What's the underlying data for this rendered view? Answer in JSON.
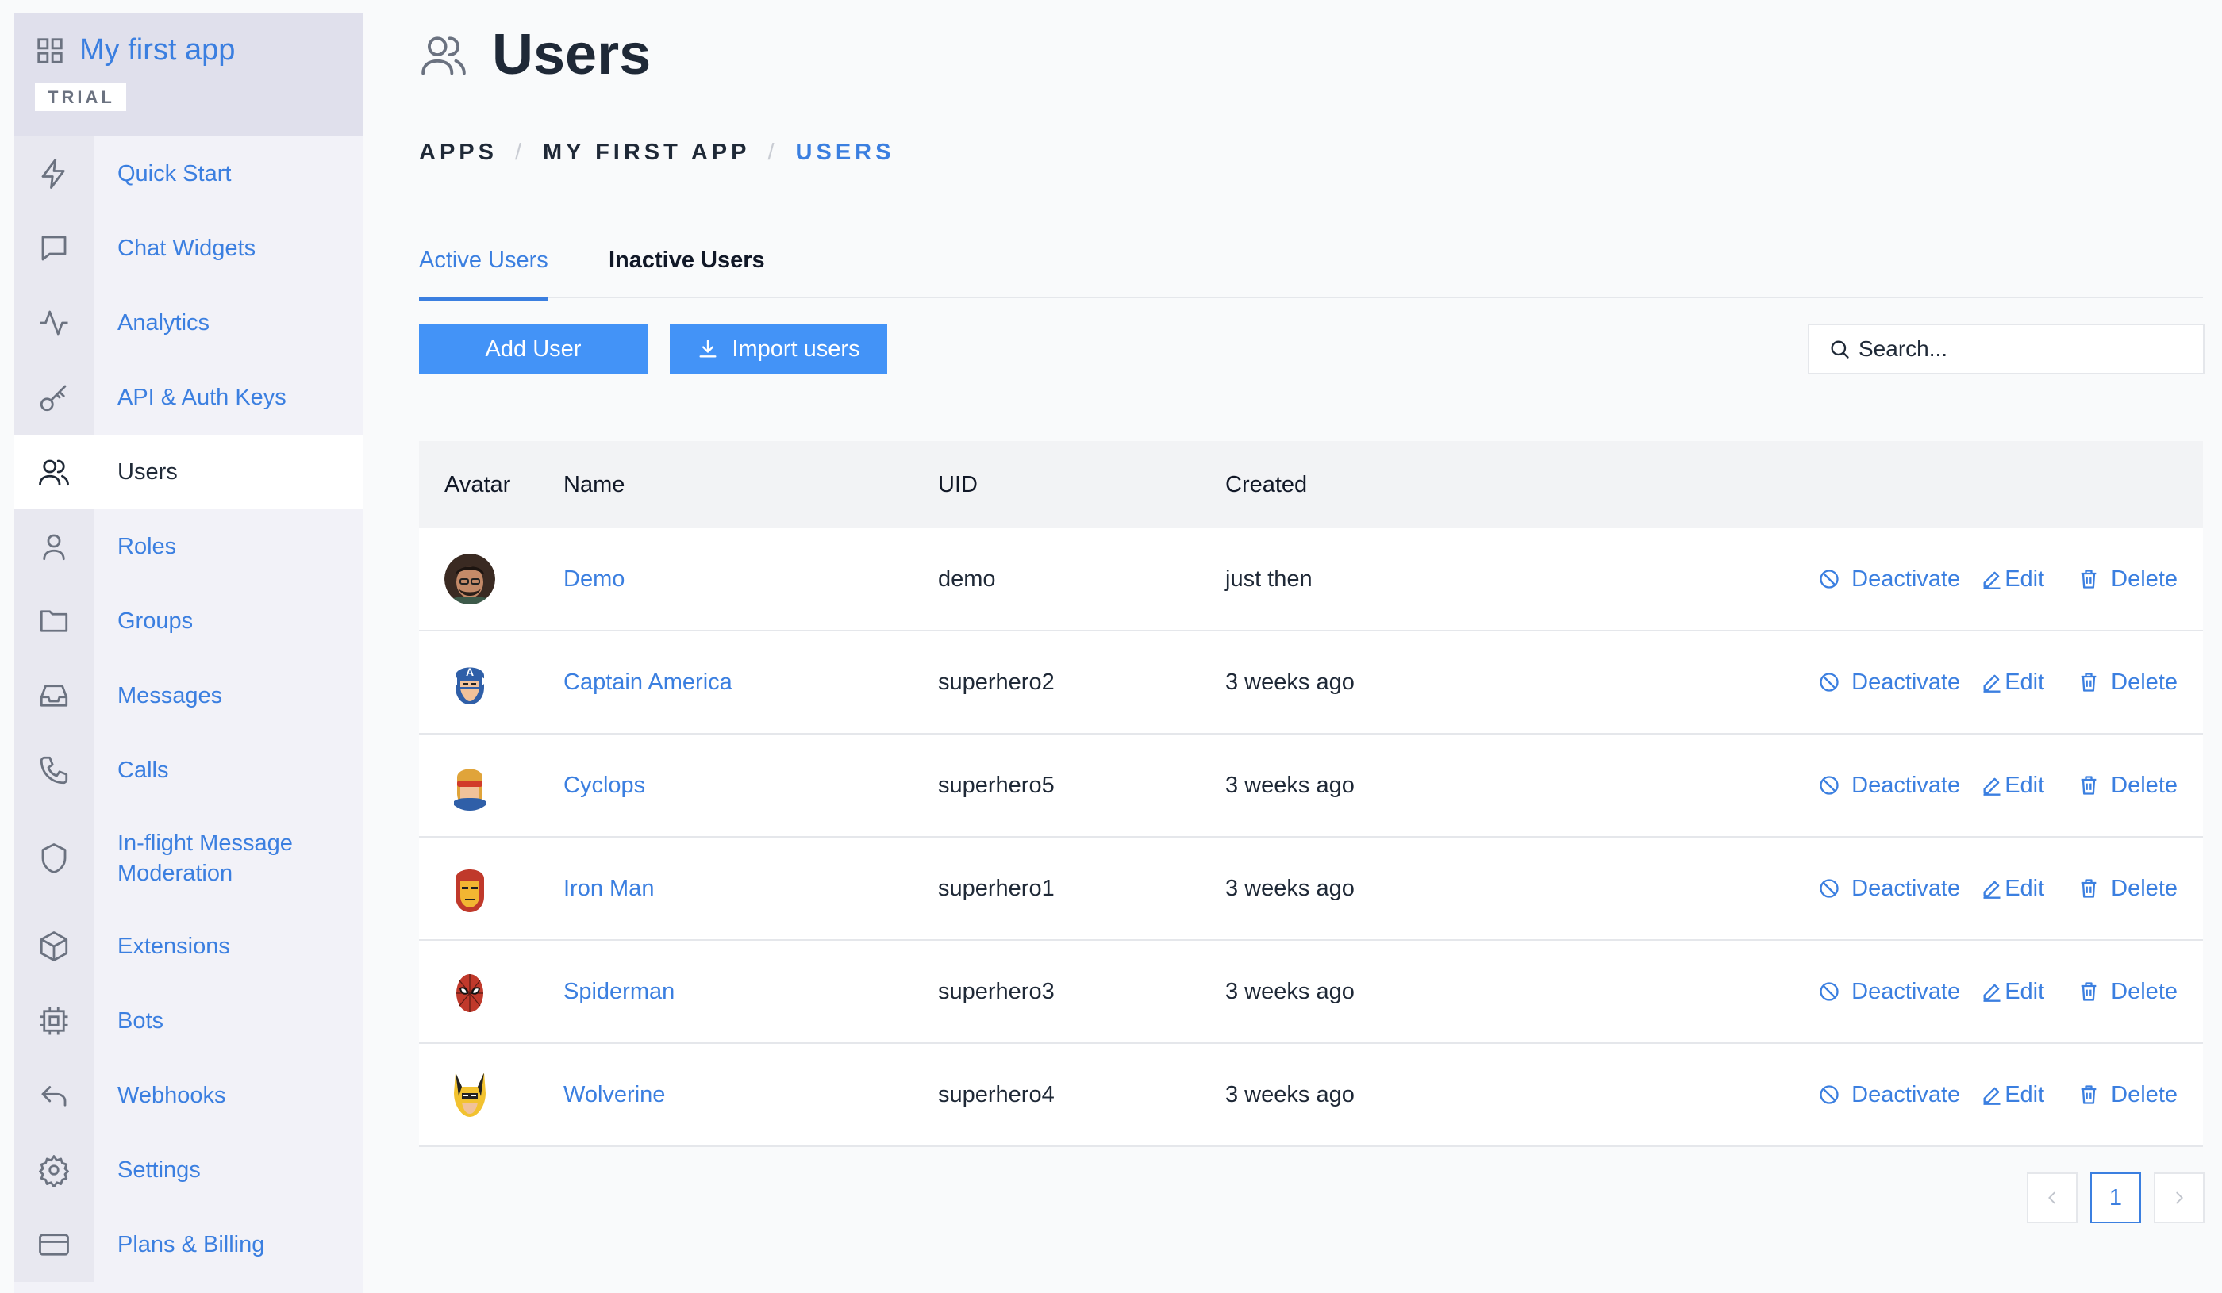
{
  "app": {
    "name": "My first app",
    "badge": "TRIAL"
  },
  "sidebar": {
    "items": [
      {
        "label": "Quick Start",
        "icon": "lightning-icon"
      },
      {
        "label": "Chat Widgets",
        "icon": "chat-icon"
      },
      {
        "label": "Analytics",
        "icon": "activity-icon"
      },
      {
        "label": "API & Auth Keys",
        "icon": "key-icon"
      },
      {
        "label": "Users",
        "icon": "users-icon",
        "active": true
      },
      {
        "label": "Roles",
        "icon": "user-icon"
      },
      {
        "label": "Groups",
        "icon": "folder-icon"
      },
      {
        "label": "Messages",
        "icon": "inbox-icon"
      },
      {
        "label": "Calls",
        "icon": "phone-icon"
      },
      {
        "label": "In-flight Message Moderation",
        "icon": "shield-icon"
      },
      {
        "label": "Extensions",
        "icon": "cube-icon"
      },
      {
        "label": "Bots",
        "icon": "chip-icon"
      },
      {
        "label": "Webhooks",
        "icon": "return-arrow-icon"
      },
      {
        "label": "Settings",
        "icon": "gear-icon"
      },
      {
        "label": "Plans & Billing",
        "icon": "credit-card-icon"
      }
    ]
  },
  "page": {
    "title": "Users"
  },
  "breadcrumb": [
    "APPS",
    "MY FIRST APP",
    "USERS"
  ],
  "tabs": {
    "active": "Active Users",
    "inactive": "Inactive Users"
  },
  "toolbar": {
    "add_label": "Add User",
    "import_label": "Import users",
    "search_placeholder": "Search..."
  },
  "table": {
    "headers": {
      "avatar": "Avatar",
      "name": "Name",
      "uid": "UID",
      "created": "Created"
    },
    "rows": [
      {
        "name": "Demo",
        "uid": "demo",
        "created": "just then",
        "avatar": "photo-avatar"
      },
      {
        "name": "Captain America",
        "uid": "superhero2",
        "created": "3 weeks ago",
        "avatar": "captain-america-avatar"
      },
      {
        "name": "Cyclops",
        "uid": "superhero5",
        "created": "3 weeks ago",
        "avatar": "cyclops-avatar"
      },
      {
        "name": "Iron Man",
        "uid": "superhero1",
        "created": "3 weeks ago",
        "avatar": "iron-man-avatar"
      },
      {
        "name": "Spiderman",
        "uid": "superhero3",
        "created": "3 weeks ago",
        "avatar": "spiderman-avatar"
      },
      {
        "name": "Wolverine",
        "uid": "superhero4",
        "created": "3 weeks ago",
        "avatar": "wolverine-avatar"
      }
    ],
    "actions": {
      "deactivate": "Deactivate",
      "edit": "Edit",
      "delete": "Delete"
    }
  },
  "pagination": {
    "current": "1"
  },
  "colors": {
    "accent": "#3b7fe0",
    "button": "#4393f7",
    "sidebar": "#f2f2f8"
  }
}
